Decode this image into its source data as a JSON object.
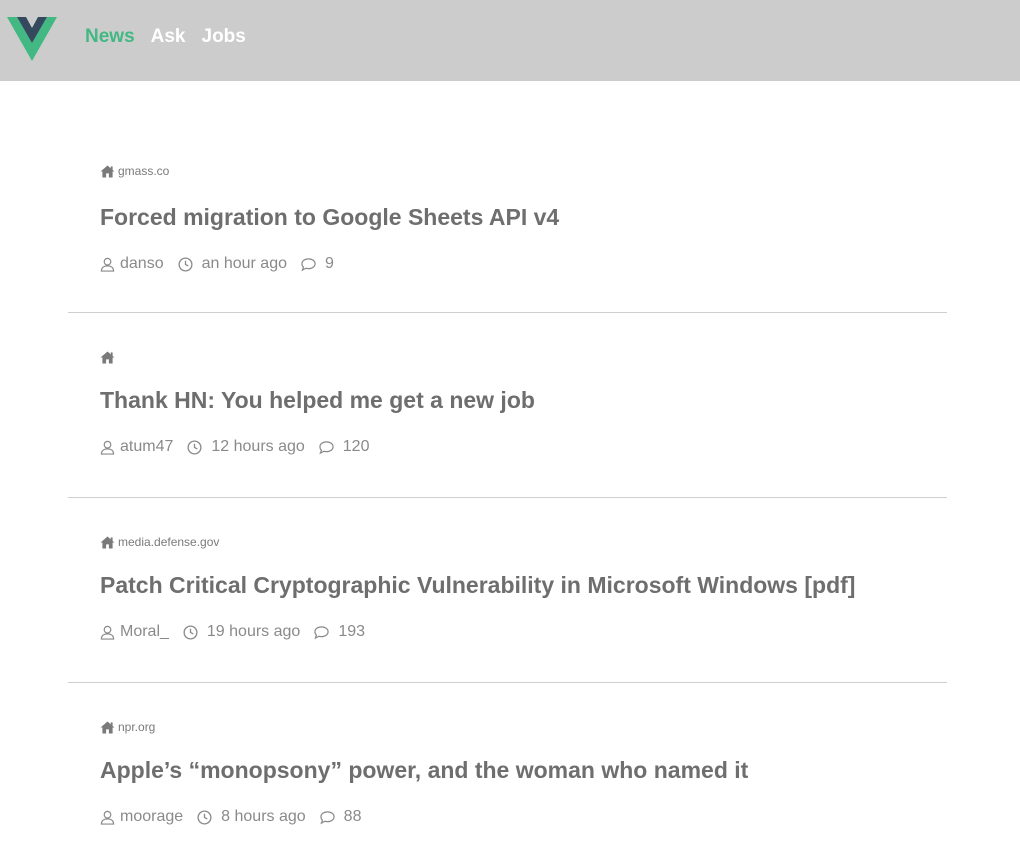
{
  "header": {
    "logo_name": "vue-logo",
    "nav": [
      {
        "label": "News",
        "active": true
      },
      {
        "label": "Ask",
        "active": false
      },
      {
        "label": "Jobs",
        "active": false
      }
    ],
    "accent_color": "#42b883",
    "bar_color": "#cccccc"
  },
  "stories": [
    {
      "domain": "gmass.co",
      "title": "Forced migration to Google Sheets API v4",
      "user": "danso",
      "time": "an hour ago",
      "comments": "9"
    },
    {
      "domain": "",
      "title": "Thank HN: You helped me get a new job",
      "user": "atum47",
      "time": "12 hours ago",
      "comments": "120"
    },
    {
      "domain": "media.defense.gov",
      "title": "Patch Critical Cryptographic Vulnerability in Microsoft Windows [pdf]",
      "user": "Moral_",
      "time": "19 hours ago",
      "comments": "193"
    },
    {
      "domain": "npr.org",
      "title": "Apple’s “monopsony” power, and the woman who named it",
      "user": "moorage",
      "time": "8 hours ago",
      "comments": "88"
    }
  ],
  "icons": {
    "domain": "home-icon",
    "user": "user-icon",
    "time": "clock-icon",
    "comments": "comment-icon"
  }
}
